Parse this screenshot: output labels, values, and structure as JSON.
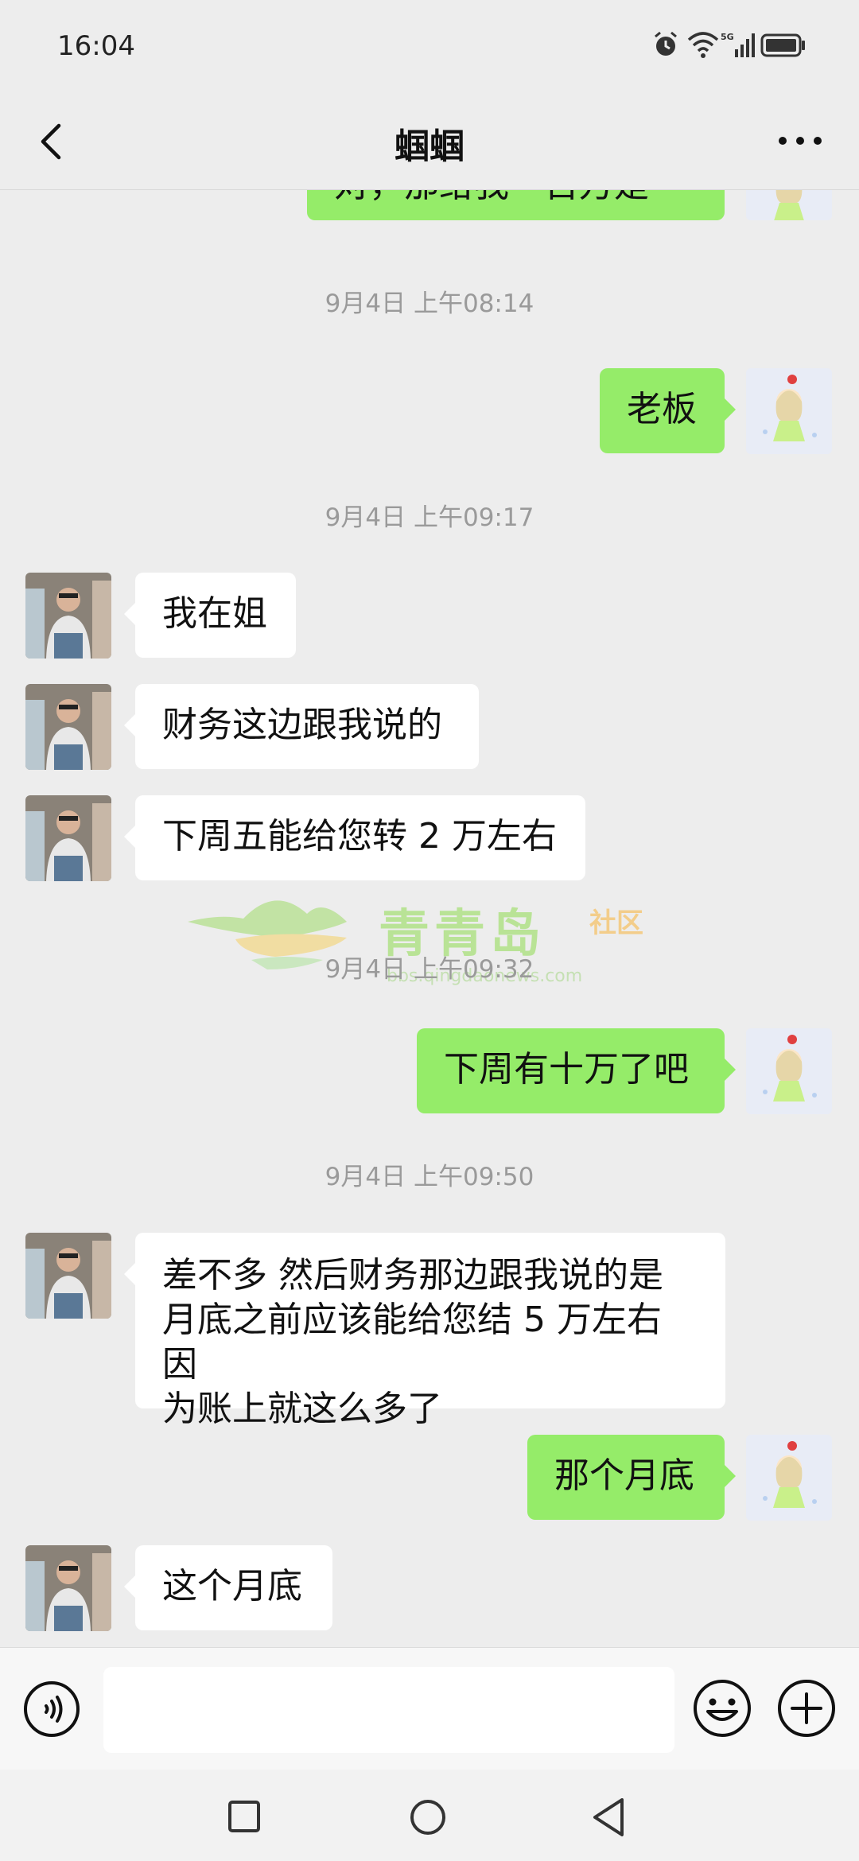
{
  "status_bar": {
    "time": "16:04",
    "network": "5G"
  },
  "header": {
    "title": "蝈蝈"
  },
  "chat": {
    "cut_off_message": "对，那给我一百万是",
    "time_labels": [
      "9月4日 上午08:14",
      "9月4日 上午09:17",
      "9月4日 上午09:32",
      "9月4日 上午09:50"
    ],
    "messages": [
      {
        "side": "out",
        "text": "老板"
      },
      {
        "side": "in",
        "text": "我在姐"
      },
      {
        "side": "in",
        "text": "财务这边跟我说的"
      },
      {
        "side": "in",
        "text": "下周五能给您转 2 万左右"
      },
      {
        "side": "out",
        "text": "下周有十万了吧"
      },
      {
        "side": "in",
        "lines": [
          "差不多 然后财务那边跟我说的是",
          "月底之前应该能给您结 5 万左右 因",
          "为账上就这么多了"
        ]
      },
      {
        "side": "out",
        "text": "那个月底"
      },
      {
        "side": "in",
        "text": "这个月底"
      }
    ]
  },
  "watermark": {
    "name": "青青岛",
    "sub": "社区",
    "url": "bbs.qingdaonews.com"
  },
  "input_bar": {
    "value": "",
    "icons": [
      "voice-icon",
      "emoji-icon",
      "plus-icon"
    ]
  },
  "system_nav": {
    "icons": [
      "recent-apps-icon",
      "home-icon",
      "back-icon"
    ]
  },
  "colors": {
    "outgoing_bubble": "#95ec69",
    "incoming_bubble": "#ffffff",
    "background": "#ededed"
  }
}
